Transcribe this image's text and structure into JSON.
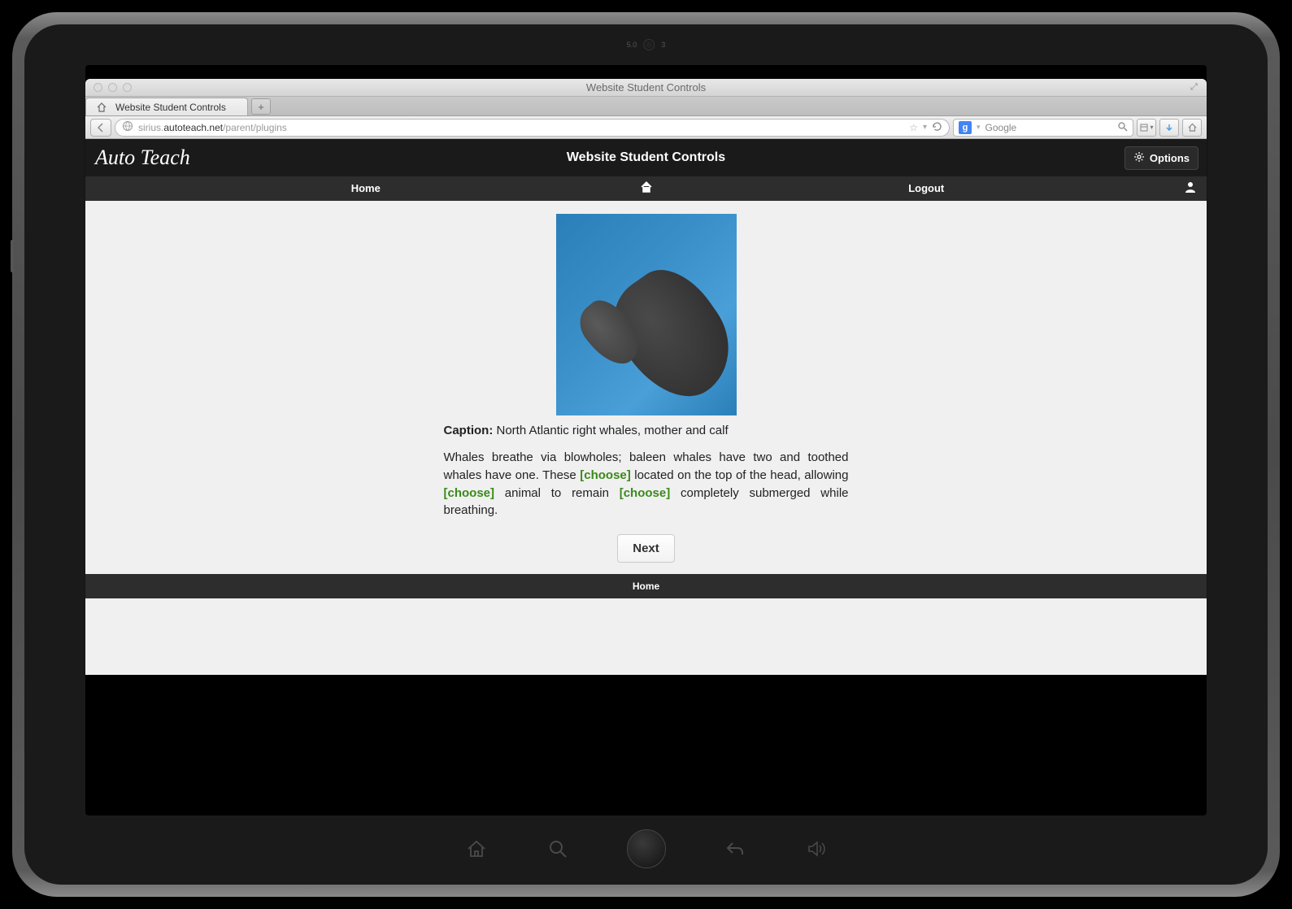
{
  "window": {
    "title": "Website Student Controls"
  },
  "tab": {
    "label": "Website Student Controls"
  },
  "url": {
    "host": "sirius.",
    "domain": "autoteach.net",
    "path": "/parent/plugins"
  },
  "search": {
    "engine_glyph": "g",
    "placeholder": "Google"
  },
  "app": {
    "logo": "Auto Teach",
    "title": "Website Student Controls",
    "options_label": "Options"
  },
  "nav": {
    "home": "Home",
    "logout": "Logout"
  },
  "lesson": {
    "caption_label": "Caption:",
    "caption_text": " North Atlantic right whales, mother and calf",
    "body_1": "Whales breathe via blowholes; baleen whales have two and toothed whales have one. These ",
    "choose_1": "[choose]",
    "body_2": " located on the top of the head, allowing ",
    "choose_2": "[choose]",
    "body_3": " animal to remain ",
    "choose_3": "[choose]",
    "body_4": " completely submerged while breathing.",
    "next_label": "Next"
  },
  "footer": {
    "home": "Home"
  }
}
